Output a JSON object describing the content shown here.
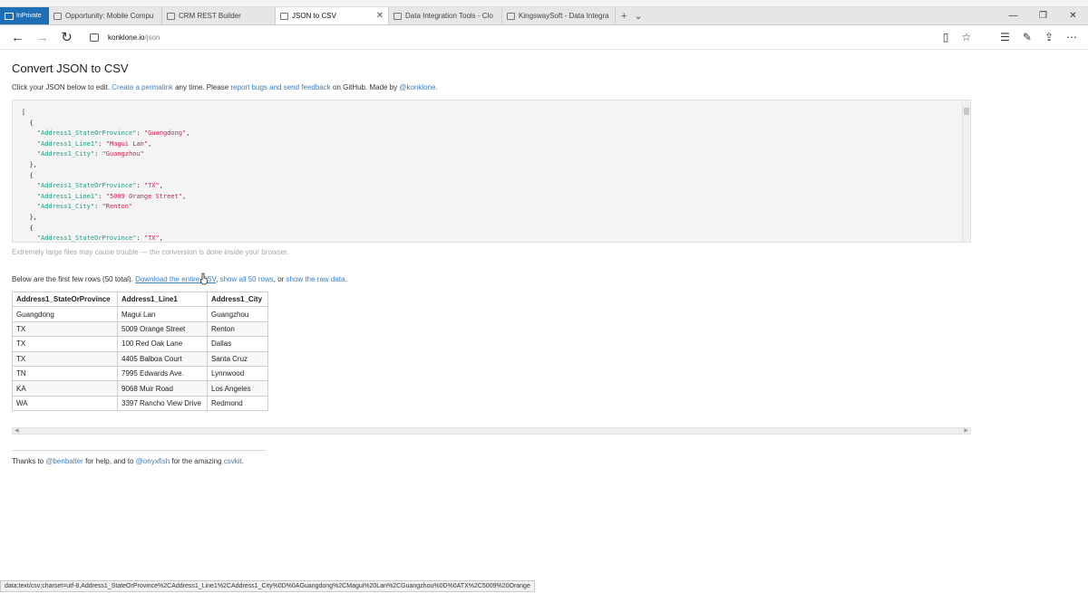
{
  "browser": {
    "private_label": "InPrivate",
    "tabs": [
      {
        "title": "Opportunity: Mobile Compu",
        "active": false
      },
      {
        "title": "CRM REST Builder",
        "active": false
      },
      {
        "title": "JSON to CSV",
        "active": true
      },
      {
        "title": "Data Integration Tools - Clo",
        "active": false
      },
      {
        "title": "KingswaySoft - Data Integra",
        "active": false
      }
    ],
    "url_host": "konklone.io",
    "url_path": "/json"
  },
  "page": {
    "title": "Convert JSON to CSV",
    "intro": {
      "t1": "Click your JSON below to edit. ",
      "link_permalink": "Create a permalink",
      "t2": " any time. Please ",
      "link_bugs": "report bugs and send feedback",
      "t3": " on GitHub. Made by ",
      "link_author": "@konklone",
      "t4": "."
    },
    "json_lines": [
      {
        "indent": "",
        "text": "["
      },
      {
        "indent": "  ",
        "text": "{"
      },
      {
        "indent": "    ",
        "key": "\"Address1_StateOrProvince\"",
        "sep": ": ",
        "value": "\"Guangdong\"",
        "end": ","
      },
      {
        "indent": "    ",
        "key": "\"Address1_Line1\"",
        "sep": ": ",
        "value": "\"Magui Lan\"",
        "end": ","
      },
      {
        "indent": "    ",
        "key": "\"Address1_City\"",
        "sep": ": ",
        "value": "\"Guangzhou\"",
        "end": ""
      },
      {
        "indent": "  ",
        "text": "},"
      },
      {
        "indent": "  ",
        "text": "{"
      },
      {
        "indent": "    ",
        "key": "\"Address1_StateOrProvince\"",
        "sep": ": ",
        "value": "\"TX\"",
        "end": ","
      },
      {
        "indent": "    ",
        "key": "\"Address1_Line1\"",
        "sep": ": ",
        "value": "\"5009 Orange Street\"",
        "end": ","
      },
      {
        "indent": "    ",
        "key": "\"Address1_City\"",
        "sep": ": ",
        "value": "\"Renton\"",
        "end": ""
      },
      {
        "indent": "  ",
        "text": "},"
      },
      {
        "indent": "  ",
        "text": "{"
      },
      {
        "indent": "    ",
        "key": "\"Address1_StateOrProvince\"",
        "sep": ": ",
        "value": "\"TX\"",
        "end": ","
      }
    ],
    "hint": "Extremely large files may cause trouble — the conversion is done inside your browser.",
    "rows_note": {
      "t1": "Below are the first few rows (50 total). ",
      "link_download": "Download the entire CSV",
      "t2": ", ",
      "link_show_all": "show all 50 rows",
      "t3": ", or ",
      "link_raw": "show the raw data",
      "t4": "."
    },
    "table": {
      "headers": [
        "Address1_StateOrProvince",
        "Address1_Line1",
        "Address1_City"
      ],
      "rows": [
        [
          "Guangdong",
          "Magui Lan",
          "Guangzhou"
        ],
        [
          "TX",
          "5009 Orange Street",
          "Renton"
        ],
        [
          "TX",
          "100 Red Oak Lane",
          "Dallas"
        ],
        [
          "TX",
          "4405 Balboa Court",
          "Santa Cruz"
        ],
        [
          "TN",
          "7995 Edwards Ave.",
          "Lynnwood"
        ],
        [
          "KA",
          "9068 Muir Road",
          "Los Angeles"
        ],
        [
          "WA",
          "3397 Rancho View Drive",
          "Redmond"
        ]
      ]
    },
    "footer": {
      "t1": "Thanks to ",
      "link_benbalter": "@benbalter",
      "t2": " for help, and to ",
      "link_onyxfish": "@onyxfish",
      "t3": " for the amazing ",
      "link_csvkit": "csvkit",
      "t4": "."
    }
  },
  "status_text": "data:text/csv;charset=utf-8,Address1_StateOrProvince%2CAddress1_Line1%2CAddress1_City%0D%0AGuangdong%2CMagui%20Lan%2CGuangzhou%0D%0ATX%2C5009%20Orange"
}
